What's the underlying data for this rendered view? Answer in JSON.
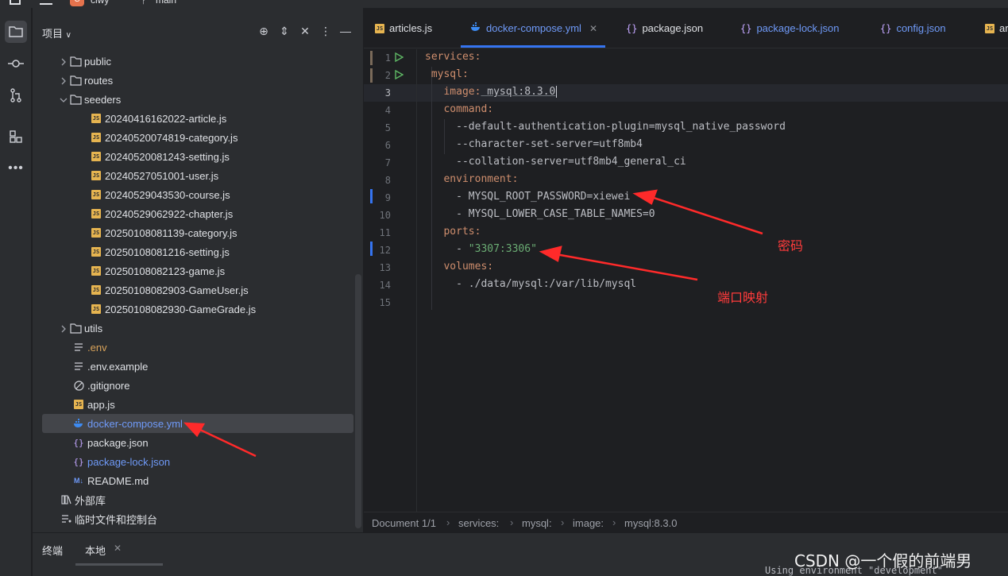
{
  "titlebar": {
    "project_badge": "C",
    "project_name": "clwy",
    "branch": "main"
  },
  "project_panel": {
    "title": "项目",
    "tree": [
      {
        "label": "public",
        "kind": "folder",
        "state": "collapsed"
      },
      {
        "label": "routes",
        "kind": "folder",
        "state": "collapsed"
      },
      {
        "label": "seeders",
        "kind": "folder",
        "state": "expanded"
      },
      {
        "label": "20240416162022-article.js",
        "kind": "js"
      },
      {
        "label": "20240520074819-category.js",
        "kind": "js"
      },
      {
        "label": "20240520081243-setting.js",
        "kind": "js"
      },
      {
        "label": "20240527051001-user.js",
        "kind": "js"
      },
      {
        "label": "20240529043530-course.js",
        "kind": "js"
      },
      {
        "label": "20240529062922-chapter.js",
        "kind": "js"
      },
      {
        "label": "20250108081139-category.js",
        "kind": "js"
      },
      {
        "label": "20250108081216-setting.js",
        "kind": "js"
      },
      {
        "label": "20250108082123-game.js",
        "kind": "js"
      },
      {
        "label": "20250108082903-GameUser.js",
        "kind": "js"
      },
      {
        "label": "20250108082930-GameGrade.js",
        "kind": "js"
      },
      {
        "label": "utils",
        "kind": "folder",
        "state": "collapsed"
      },
      {
        "label": ".env",
        "kind": "text"
      },
      {
        "label": ".env.example",
        "kind": "text"
      },
      {
        "label": ".gitignore",
        "kind": "ignore"
      },
      {
        "label": "app.js",
        "kind": "js"
      },
      {
        "label": "docker-compose.yml",
        "kind": "docker"
      },
      {
        "label": "package.json",
        "kind": "json"
      },
      {
        "label": "package-lock.json",
        "kind": "json"
      },
      {
        "label": "README.md",
        "kind": "md"
      },
      {
        "label": "外部库",
        "kind": "library"
      },
      {
        "label": "临时文件和控制台",
        "kind": "scratch"
      }
    ]
  },
  "tabs": [
    {
      "label": "articles.js",
      "kind": "js"
    },
    {
      "label": "docker-compose.yml",
      "kind": "docker",
      "active": true
    },
    {
      "label": "package.json",
      "kind": "json"
    },
    {
      "label": "package-lock.json",
      "kind": "json"
    },
    {
      "label": "config.json",
      "kind": "json"
    },
    {
      "label": "ar",
      "kind": "js"
    }
  ],
  "editor": {
    "line_numbers": [
      "1",
      "2",
      "3",
      "4",
      "5",
      "6",
      "7",
      "8",
      "9",
      "10",
      "11",
      "12",
      "13",
      "14",
      "15"
    ],
    "lines": {
      "l1": "services:",
      "l2": " mysql:",
      "l3_key": "   image:",
      "l3_val": " mysql:8.3.0",
      "l4": "   command:",
      "l5": "     --default-authentication-plugin=mysql_native_password",
      "l6": "     --character-set-server=utf8mb4",
      "l7": "     --collation-server=utf8mb4_general_ci",
      "l8": "   environment:",
      "l9": "     - MYSQL_ROOT_PASSWORD=xiewei",
      "l10": "     - MYSQL_LOWER_CASE_TABLE_NAMES=0",
      "l11": "   ports:",
      "l12_dash": "     - ",
      "l12_str": "\"3307:3306\"",
      "l13": "   volumes:",
      "l14": "     - ./data/mysql:/var/lib/mysql"
    }
  },
  "breadcrumb": [
    "Document 1/1",
    "services:",
    "mysql:",
    "image:",
    "mysql:8.3.0"
  ],
  "annotations": {
    "password": "密码",
    "port_mapping": "端口映射"
  },
  "bottom_panel": {
    "title": "终端",
    "tab": "本地",
    "output": "Using environment \"development\""
  },
  "watermark": "CSDN @一个假的前端男",
  "colors": {
    "accent": "#3574f0",
    "annotation": "#ff3b3b",
    "keyword": "#cf8e6d",
    "string": "#6aab73"
  }
}
